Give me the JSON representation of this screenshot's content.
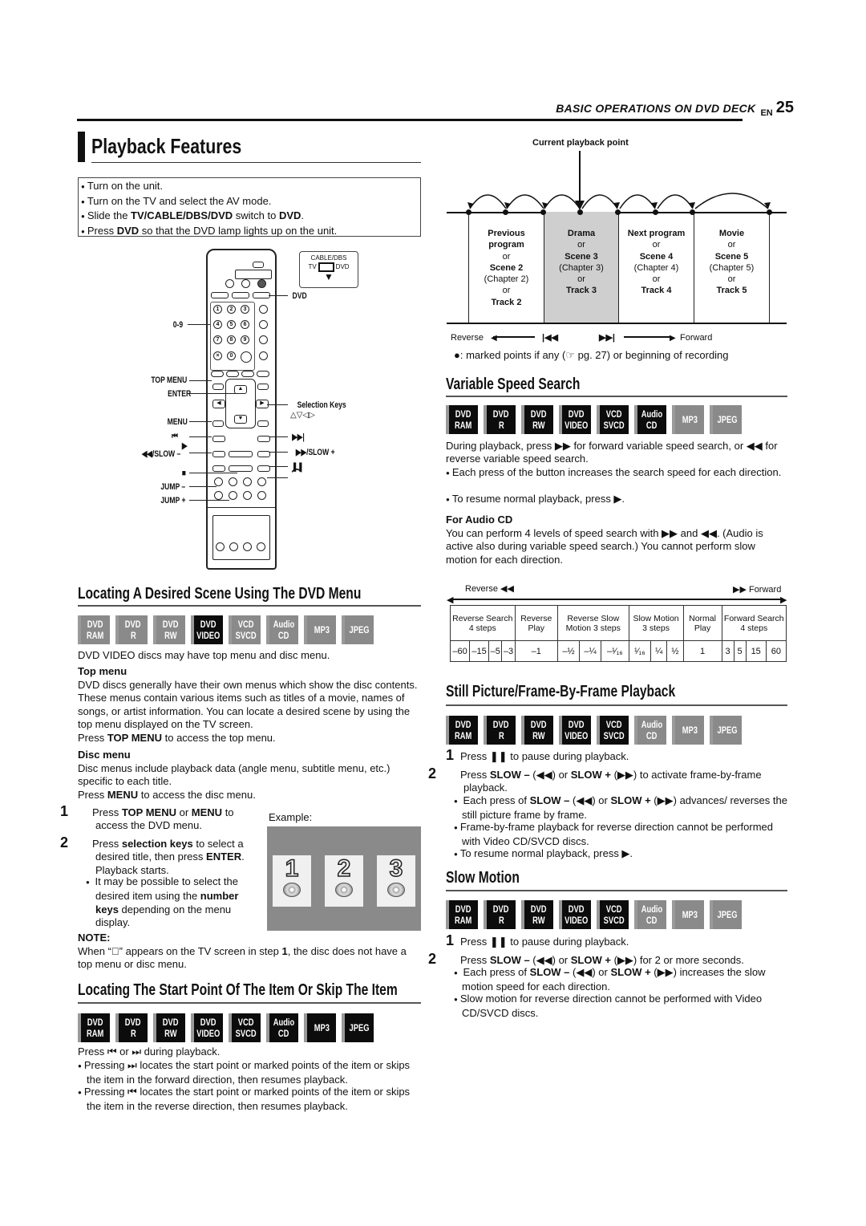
{
  "header": {
    "section": "BASIC OPERATIONS ON DVD DECK",
    "lang": "EN",
    "page_number": "25"
  },
  "main_title": "Playback Features",
  "prep": [
    {
      "pre": "Turn on the unit.",
      "b1": "",
      "mid": "",
      "b2": "",
      "post": ""
    },
    {
      "pre": "Turn on the TV and select the AV mode.",
      "b1": "",
      "mid": "",
      "b2": "",
      "post": ""
    },
    {
      "pre": "Slide the ",
      "b1": "TV/CABLE/DBS/DVD",
      "mid": " switch to ",
      "b2": "DVD",
      "post": "."
    },
    {
      "pre": "Press ",
      "b1": "DVD",
      "mid": " so that the DVD lamp lights up on the unit.",
      "b2": "",
      "post": ""
    }
  ],
  "remote": {
    "switch_labels": {
      "top": "CABLE/DBS",
      "left": "TV",
      "right": "DVD"
    },
    "callouts_left": {
      "digits": "0-9",
      "top_menu": "TOP MENU",
      "enter": "ENTER",
      "menu": "MENU",
      "prev": "⏮",
      "play": "▶",
      "slow_minus": "◀◀/SLOW –",
      "stop": "■",
      "jump_minus": "JUMP –",
      "jump_plus": "JUMP +"
    },
    "callouts_right": {
      "dvd": "DVD",
      "selection_keys": "Selection Keys",
      "selection_glyphs": "△▽◁▷",
      "next": "▶▶|",
      "slow_plus": "▶▶/SLOW +",
      "pause": "❚❚",
      "repeat": "⌒"
    },
    "digits": [
      "1",
      "2",
      "3",
      "4",
      "5",
      "6",
      "7",
      "8",
      "9",
      "×",
      "0",
      ""
    ]
  },
  "dvd_menu": {
    "title": "Locating A Desired Scene Using The DVD Menu",
    "badges_active": [
      false,
      false,
      false,
      true,
      false,
      false,
      false,
      false
    ],
    "intro": "DVD VIDEO discs may have top menu and disc menu.",
    "top_menu_heading": "Top menu",
    "top_menu_text": "DVD discs generally have their own menus which show the disc contents. These menus contain various items such as titles of a movie, names of songs, or artist information. You can locate a desired scene by using the top menu displayed on the TV screen.",
    "top_menu_press": {
      "pre": "Press ",
      "b": "TOP MENU",
      "post": " to access the top menu."
    },
    "disc_menu_heading": "Disc menu",
    "disc_menu_text": "Disc menus include playback data (angle menu, subtitle menu, etc.) specific to each title.",
    "disc_menu_press": {
      "pre": "Press ",
      "b": "MENU",
      "post": " to access the disc menu."
    },
    "step1": {
      "num": "1",
      "pre": "Press ",
      "b1": "TOP MENU",
      "mid": " or ",
      "b2": "MENU",
      "post": " to access the DVD menu."
    },
    "step2": {
      "num": "2",
      "pre": "Press ",
      "b1": "selection keys",
      "mid": " to select a desired title, then press ",
      "b2": "ENTER",
      "post": ". Playback starts."
    },
    "step2_note": {
      "pre": "It may be possible to select the desired item using the ",
      "b": "number keys",
      "post": " depending on the menu display."
    },
    "example_label": "Example:",
    "example_items": [
      "1",
      "2",
      "3"
    ],
    "note_heading": "NOTE:",
    "note": {
      "pre": "When “⃠” appears on the TV screen in step ",
      "b": "1",
      "post": ", the disc does not have a top menu or disc menu."
    }
  },
  "skip": {
    "title": "Locating The Start Point Of The Item Or Skip The Item",
    "badges_active": [
      true,
      true,
      true,
      true,
      true,
      true,
      true,
      true
    ],
    "intro": "Press ⏮ or ⏭ during playback.",
    "bullets": [
      "Pressing ⏭ locates the start point or marked points of the item or skips the item in the forward direction, then resumes playback.",
      "Pressing ⏮ locates the start point or marked points of the item or skips the item in the reverse direction, then resumes playback."
    ]
  },
  "diagram": {
    "current_label": "Current playback point",
    "cells": [
      {
        "l1": "Previous",
        "l2": "program",
        "or1": "or",
        "scene": "Scene 2",
        "chapter": "(Chapter 2)",
        "or2": "or",
        "track": "Track 2",
        "current": false
      },
      {
        "l1": "Drama",
        "l2": "",
        "or1": "or",
        "scene": "Scene 3",
        "chapter": "(Chapter 3)",
        "or2": "or",
        "track": "Track 3",
        "current": true
      },
      {
        "l1": "Next program",
        "l2": "",
        "or1": "or",
        "scene": "Scene 4",
        "chapter": "(Chapter 4)",
        "or2": "or",
        "track": "Track 4",
        "current": false
      },
      {
        "l1": "Movie",
        "l2": "",
        "or1": "or",
        "scene": "Scene 5",
        "chapter": "(Chapter 5)",
        "or2": "or",
        "track": "Track 5",
        "current": false
      }
    ],
    "reverse": "Reverse",
    "forward": "Forward",
    "prev_glyph": "|◀◀",
    "next_glyph": "▶▶|",
    "legend": "●: marked points if any (☞ pg. 27) or beginning of recording"
  },
  "badge_labels": [
    [
      "DVD",
      "RAM"
    ],
    [
      "DVD",
      "R"
    ],
    [
      "DVD",
      "RW"
    ],
    [
      "DVD",
      "VIDEO"
    ],
    [
      "VCD",
      "SVCD"
    ],
    [
      "Audio",
      "CD"
    ],
    [
      "MP3",
      ""
    ],
    [
      "JPEG",
      ""
    ]
  ],
  "variable_speed": {
    "title": "Variable Speed Search",
    "badges_active": [
      true,
      true,
      true,
      true,
      true,
      true,
      false,
      false
    ],
    "p1": "During playback, press ▶▶ for forward variable speed search, or ◀◀ for reverse variable speed search.",
    "bullets": [
      "Each press of the button increases the search speed for each direction.",
      "To resume normal playback, press ▶."
    ],
    "audio_cd_heading": "For Audio CD",
    "audio_cd_text": "You can perform 4 levels of speed search with ▶▶ and ◀◀. (Audio is active also during variable speed search.) You cannot perform slow motion for each direction."
  },
  "speed_table": {
    "reverse_label": "Reverse ◀◀",
    "forward_label": "▶▶ Forward",
    "groups": [
      {
        "label": "Reverse Search 4 steps",
        "values": [
          "–60",
          "–15",
          "–5",
          "–3"
        ]
      },
      {
        "label": "Reverse Play",
        "values": [
          "–1"
        ]
      },
      {
        "label": "Reverse Slow Motion 3 steps",
        "values": [
          "–½",
          "–¼",
          "–¹⁄₁₆"
        ]
      },
      {
        "label": "Slow Motion 3 steps",
        "values": [
          "¹⁄₁₆",
          "¼",
          "½"
        ]
      },
      {
        "label": "Normal Play",
        "values": [
          "1"
        ]
      },
      {
        "label": "Forward Search 4 steps",
        "values": [
          "3",
          "5",
          "15",
          "60"
        ]
      }
    ]
  },
  "still": {
    "title": "Still Picture/Frame-By-Frame Playback",
    "badges_active": [
      true,
      true,
      true,
      true,
      true,
      false,
      false,
      false
    ],
    "step1": "Press ❚❚ to pause during playback.",
    "step2": {
      "pre": "Press ",
      "b1": "SLOW –",
      "mid": " (◀◀) or ",
      "b2": "SLOW +",
      "post": " (▶▶) to activate frame-by-frame playback."
    },
    "bullet1": {
      "pre": "Each press of ",
      "b1": "SLOW –",
      "mid": " (◀◀) or ",
      "b2": "SLOW +",
      "post": " (▶▶) advances/ reverses the still picture frame by frame."
    },
    "bullet2": "Frame-by-frame playback for reverse direction cannot be performed with Video CD/SVCD discs.",
    "bullet3": "To resume normal playback, press ▶."
  },
  "slow": {
    "title": "Slow Motion",
    "badges_active": [
      true,
      true,
      true,
      true,
      true,
      false,
      false,
      false
    ],
    "step1": "Press ❚❚ to pause during playback.",
    "step2": {
      "pre": "Press ",
      "b1": "SLOW –",
      "mid": " (◀◀) or ",
      "b2": "SLOW +",
      "post": " (▶▶) for 2 or more seconds."
    },
    "bullet1": {
      "pre": "Each press of ",
      "b1": "SLOW –",
      "mid": " (◀◀) or ",
      "b2": "SLOW +",
      "post": " (▶▶) increases the slow motion speed for each direction."
    },
    "bullet2": "Slow motion for reverse direction cannot be performed with Video CD/SVCD discs."
  }
}
